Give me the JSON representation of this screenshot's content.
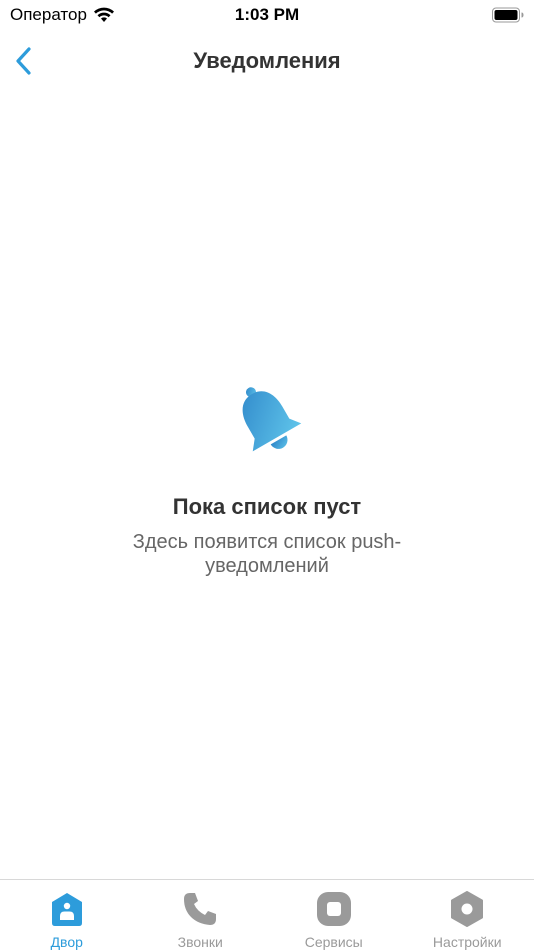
{
  "status_bar": {
    "carrier": "Оператор",
    "time": "1:03 PM"
  },
  "nav": {
    "title": "Уведомления"
  },
  "empty_state": {
    "title": "Пока список пуст",
    "subtitle": "Здесь появится список push-уведомлений",
    "icon": "bell-icon"
  },
  "tabs": [
    {
      "label": "Двор",
      "icon": "home-icon",
      "active": true
    },
    {
      "label": "Звонки",
      "icon": "phone-icon",
      "active": false
    },
    {
      "label": "Сервисы",
      "icon": "services-icon",
      "active": false
    },
    {
      "label": "Настройки",
      "icon": "settings-icon",
      "active": false
    }
  ],
  "colors": {
    "accent": "#2d9cdb",
    "inactive": "#9a9a9a"
  }
}
